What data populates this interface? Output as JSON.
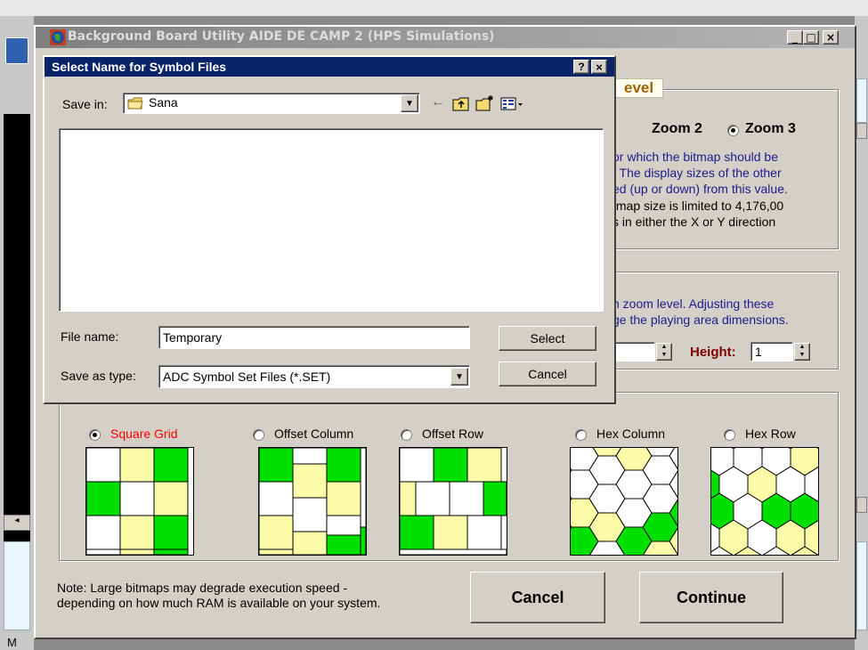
{
  "main_window": {
    "title": "Background Board Utility  AIDE DE CAMP 2  (HPS Simulations)",
    "controls": {
      "minimize": "_",
      "maximize": "□",
      "close": "×"
    }
  },
  "zoom_section": {
    "legend_fragment": "evel",
    "options": [
      {
        "label": "Zoom 2",
        "selected": false
      },
      {
        "label": "Zoom 3",
        "selected": true
      }
    ],
    "help_lines": [
      "or which the bitmap should be",
      ".  The display sizes of the other",
      "ed (up or down) from this value."
    ],
    "limit_lines": [
      "tmap size is limited to 4,176,00",
      "s in either the X or Y direction"
    ]
  },
  "size_section": {
    "help_lines": [
      "h zoom level.  Adjusting these",
      "ge the playing area dimensions."
    ],
    "width_value": "",
    "height_label": "Height:",
    "height_value": "1"
  },
  "grid_section": {
    "options": [
      {
        "label": "Square Grid",
        "selected": true
      },
      {
        "label": "Offset Column",
        "selected": false
      },
      {
        "label": "Offset Row",
        "selected": false
      },
      {
        "label": "Hex Column",
        "selected": false
      },
      {
        "label": "Hex Row",
        "selected": false
      }
    ],
    "colors": {
      "green": "#00e000",
      "yellow": "#fcfca8",
      "white": "#ffffff",
      "selected_text": "#ff0000"
    }
  },
  "footer": {
    "note_line1": "Note:  Large bitmaps may degrade execution speed -",
    "note_line2": "depending on how much RAM is available on your system.",
    "cancel_label": "Cancel",
    "continue_label": "Continue"
  },
  "file_dialog": {
    "title": "Select Name for Symbol Files",
    "help_button": "?",
    "close_button": "×",
    "save_in_label": "Save in:",
    "save_in_value": "Sana",
    "file_name_label": "File name:",
    "file_name_value": "Temporary",
    "save_as_type_label": "Save as type:",
    "save_as_type_value": "ADC Symbol Set Files (*.SET)",
    "select_label": "Select",
    "cancel_label": "Cancel",
    "toolbar_icons": [
      "back-arrow-icon",
      "up-folder-icon",
      "new-folder-icon",
      "view-menu-icon"
    ]
  },
  "background_app": {
    "status_fragment": "M"
  }
}
